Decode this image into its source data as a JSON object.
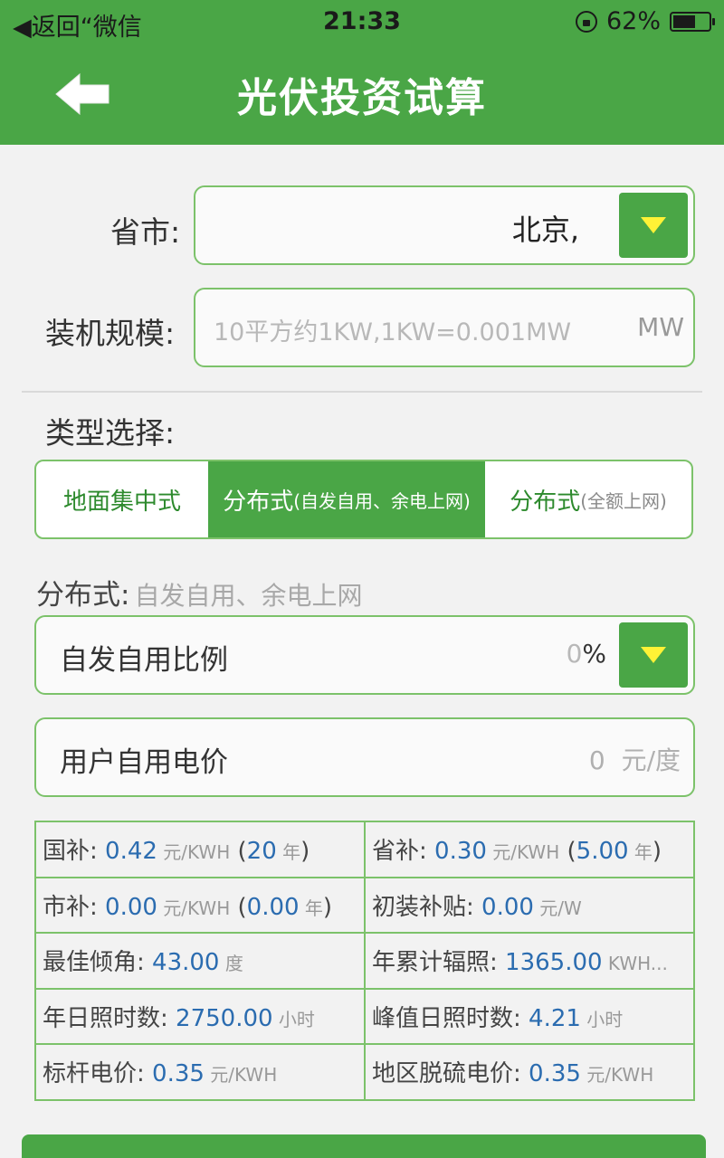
{
  "status_bar": {
    "back_label": "◀返回“微信",
    "time": "21:33",
    "battery": "62%",
    "battery_level": 0.62
  },
  "header": {
    "title": "光伏投资试算"
  },
  "province": {
    "label": "省市:",
    "value": "北京,"
  },
  "capacity": {
    "label": "装机规模:",
    "placeholder": "10平方约1KW,1KW=0.001MW",
    "unit": "MW"
  },
  "type_select": {
    "label": "类型选择:",
    "options": [
      {
        "main": "地面集中式",
        "sub": ""
      },
      {
        "main": "分布式",
        "sub": "(自发自用、余电上网)"
      },
      {
        "main": "分布式",
        "sub": "(全额上网)"
      }
    ]
  },
  "distributed": {
    "label": "分布式:",
    "desc": "自发自用、余电上网",
    "self_use_ratio": {
      "label": "自发自用比例",
      "value": "0",
      "unit": "%"
    },
    "self_use_price": {
      "label": "用户自用电价",
      "value": "0",
      "unit": "元/度"
    }
  },
  "params": [
    [
      {
        "label": "国补: ",
        "value": "0.42",
        "unit": " 元/KWH",
        "extra_open": " (",
        "extra_value": "20",
        "extra_unit": " 年",
        "extra_close": ")"
      },
      {
        "label": "省补: ",
        "value": "0.30",
        "unit": " 元/KWH",
        "extra_open": " (",
        "extra_value": "5.00",
        "extra_unit": " 年",
        "extra_close": ")"
      }
    ],
    [
      {
        "label": "市补: ",
        "value": "0.00",
        "unit": " 元/KWH",
        "extra_open": " (",
        "extra_value": "0.00",
        "extra_unit": " 年",
        "extra_close": ")"
      },
      {
        "label": "初装补贴: ",
        "value": "0.00",
        "unit": " 元/W"
      }
    ],
    [
      {
        "label": "最佳倾角: ",
        "value": "43.00",
        "unit": " 度"
      },
      {
        "label": "年累计辐照: ",
        "value": "1365.00",
        "unit": " KWH..."
      }
    ],
    [
      {
        "label": "年日照时数: ",
        "value": "2750.00",
        "unit": " 小时"
      },
      {
        "label": "峰值日照时数: ",
        "value": "4.21",
        "unit": " 小时"
      }
    ],
    [
      {
        "label": "标杆电价: ",
        "value": "0.35",
        "unit": " 元/KWH"
      },
      {
        "label": "地区脱硫电价: ",
        "value": "0.35",
        "unit": " 元/KWH"
      }
    ]
  ]
}
